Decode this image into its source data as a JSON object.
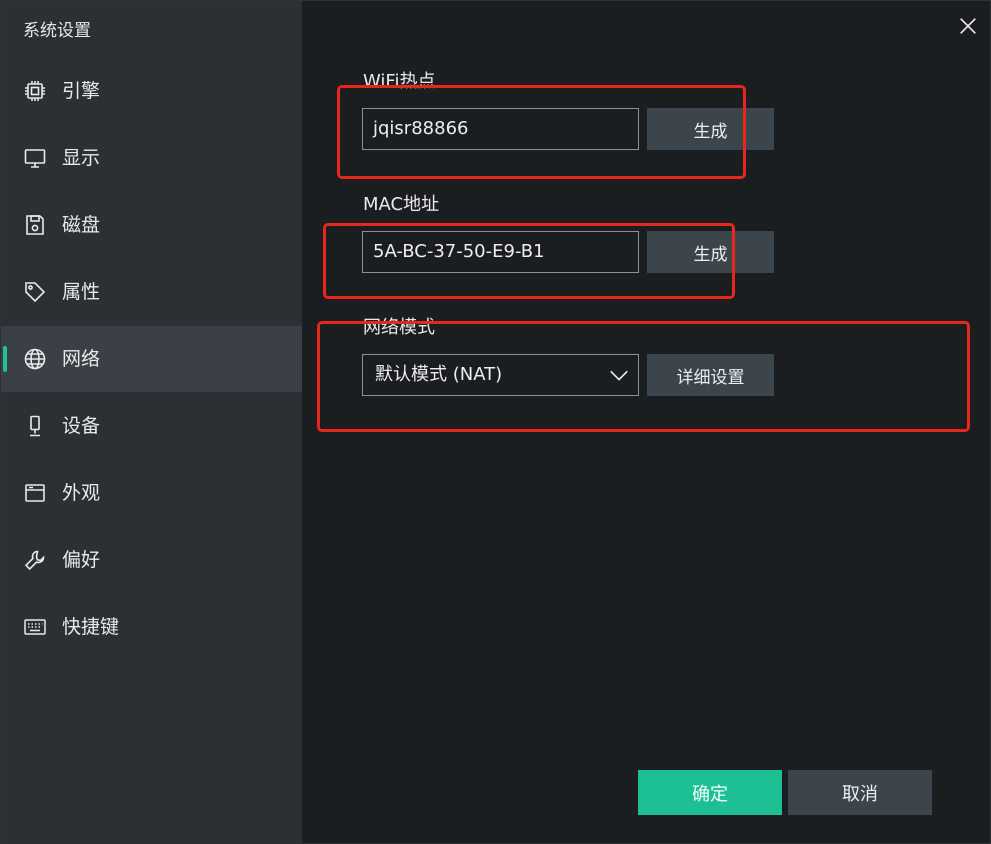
{
  "window": {
    "title": "系统设置"
  },
  "sidebar": {
    "items": [
      {
        "label": "引擎",
        "icon": "cpu-icon",
        "active": false
      },
      {
        "label": "显示",
        "icon": "monitor-icon",
        "active": false
      },
      {
        "label": "磁盘",
        "icon": "save-icon",
        "active": false
      },
      {
        "label": "属性",
        "icon": "tag-icon",
        "active": false
      },
      {
        "label": "网络",
        "icon": "globe-icon",
        "active": true
      },
      {
        "label": "设备",
        "icon": "device-icon",
        "active": false
      },
      {
        "label": "外观",
        "icon": "window-icon",
        "active": false
      },
      {
        "label": "偏好",
        "icon": "wrench-icon",
        "active": false
      },
      {
        "label": "快捷键",
        "icon": "keyboard-icon",
        "active": false
      }
    ]
  },
  "network": {
    "wifi": {
      "label": "WiFi热点",
      "value": "jqisr88866",
      "generate_label": "生成"
    },
    "mac": {
      "label": "MAC地址",
      "value": "5A-BC-37-50-E9-B1",
      "generate_label": "生成"
    },
    "mode": {
      "label": "网络模式",
      "selected": "默认模式 (NAT)",
      "details_label": "详细设置"
    }
  },
  "footer": {
    "confirm_label": "确定",
    "cancel_label": "取消"
  },
  "colors": {
    "accent": "#1dbf95",
    "annotation": "#e8271c",
    "sidebar_bg": "#2b3034",
    "content_bg": "#1b1e21"
  }
}
